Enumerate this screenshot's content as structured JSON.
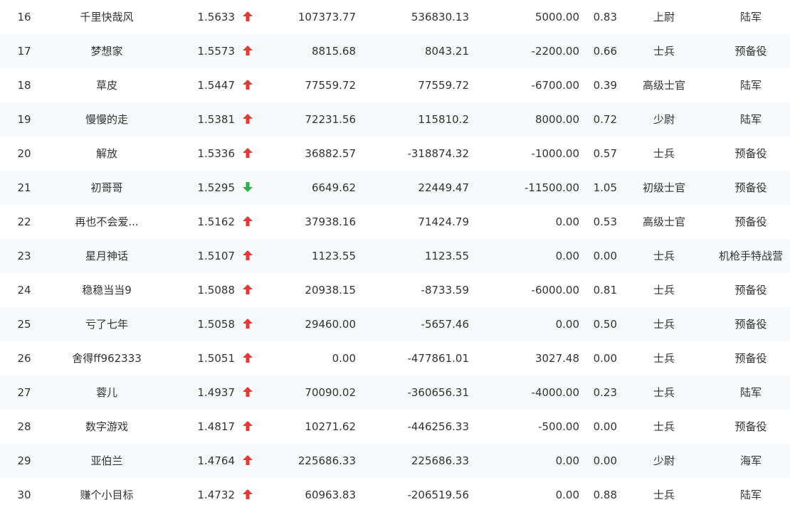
{
  "theme": {
    "up_color": "#e53935",
    "down_color": "#2bb24c"
  },
  "rows": [
    {
      "rank": "16",
      "name": "千里快哉风",
      "ratio": "1.5633",
      "trend": "up",
      "v1": "107373.77",
      "v2": "536830.13",
      "v3": "5000.00",
      "v4": "0.83",
      "rank_title": "上尉",
      "branch": "陆军"
    },
    {
      "rank": "17",
      "name": "梦想家",
      "ratio": "1.5573",
      "trend": "up",
      "v1": "8815.68",
      "v2": "8043.21",
      "v3": "-2200.00",
      "v4": "0.66",
      "rank_title": "士兵",
      "branch": "预备役"
    },
    {
      "rank": "18",
      "name": "草皮",
      "ratio": "1.5447",
      "trend": "up",
      "v1": "77559.72",
      "v2": "77559.72",
      "v3": "-6700.00",
      "v4": "0.39",
      "rank_title": "高级士官",
      "branch": "陆军"
    },
    {
      "rank": "19",
      "name": "慢慢的走",
      "ratio": "1.5381",
      "trend": "up",
      "v1": "72231.56",
      "v2": "115810.2",
      "v3": "8000.00",
      "v4": "0.72",
      "rank_title": "少尉",
      "branch": "陆军"
    },
    {
      "rank": "20",
      "name": "解放",
      "ratio": "1.5336",
      "trend": "up",
      "v1": "36882.57",
      "v2": "-318874.32",
      "v3": "-1000.00",
      "v4": "0.57",
      "rank_title": "士兵",
      "branch": "预备役"
    },
    {
      "rank": "21",
      "name": "初哥哥",
      "ratio": "1.5295",
      "trend": "down",
      "v1": "6649.62",
      "v2": "22449.47",
      "v3": "-11500.00",
      "v4": "1.05",
      "rank_title": "初级士官",
      "branch": "预备役"
    },
    {
      "rank": "22",
      "name": "再也不会爱...",
      "ratio": "1.5162",
      "trend": "up",
      "v1": "37938.16",
      "v2": "71424.79",
      "v3": "0.00",
      "v4": "0.53",
      "rank_title": "高级士官",
      "branch": "预备役"
    },
    {
      "rank": "23",
      "name": "星月神话",
      "ratio": "1.5107",
      "trend": "up",
      "v1": "1123.55",
      "v2": "1123.55",
      "v3": "0.00",
      "v4": "0.00",
      "rank_title": "士兵",
      "branch": "机枪手特战营"
    },
    {
      "rank": "24",
      "name": "稳稳当当9",
      "ratio": "1.5088",
      "trend": "up",
      "v1": "20938.15",
      "v2": "-8733.59",
      "v3": "-6000.00",
      "v4": "0.81",
      "rank_title": "士兵",
      "branch": "预备役"
    },
    {
      "rank": "25",
      "name": "亏了七年",
      "ratio": "1.5058",
      "trend": "up",
      "v1": "29460.00",
      "v2": "-5657.46",
      "v3": "0.00",
      "v4": "0.50",
      "rank_title": "士兵",
      "branch": "预备役"
    },
    {
      "rank": "26",
      "name": "舍得ff962333",
      "ratio": "1.5051",
      "trend": "up",
      "v1": "0.00",
      "v2": "-477861.01",
      "v3": "3027.48",
      "v4": "0.00",
      "rank_title": "士兵",
      "branch": "预备役"
    },
    {
      "rank": "27",
      "name": "蓉儿",
      "ratio": "1.4937",
      "trend": "up",
      "v1": "70090.02",
      "v2": "-360656.31",
      "v3": "-4000.00",
      "v4": "0.23",
      "rank_title": "士兵",
      "branch": "陆军"
    },
    {
      "rank": "28",
      "name": "数字游戏",
      "ratio": "1.4817",
      "trend": "up",
      "v1": "10271.62",
      "v2": "-446256.33",
      "v3": "-500.00",
      "v4": "0.00",
      "rank_title": "士兵",
      "branch": "预备役"
    },
    {
      "rank": "29",
      "name": "亚伯兰",
      "ratio": "1.4764",
      "trend": "up",
      "v1": "225686.33",
      "v2": "225686.33",
      "v3": "0.00",
      "v4": "0.00",
      "rank_title": "少尉",
      "branch": "海军"
    },
    {
      "rank": "30",
      "name": "赚个小目标",
      "ratio": "1.4732",
      "trend": "up",
      "v1": "60963.83",
      "v2": "-206519.56",
      "v3": "0.00",
      "v4": "0.88",
      "rank_title": "士兵",
      "branch": "陆军"
    }
  ]
}
